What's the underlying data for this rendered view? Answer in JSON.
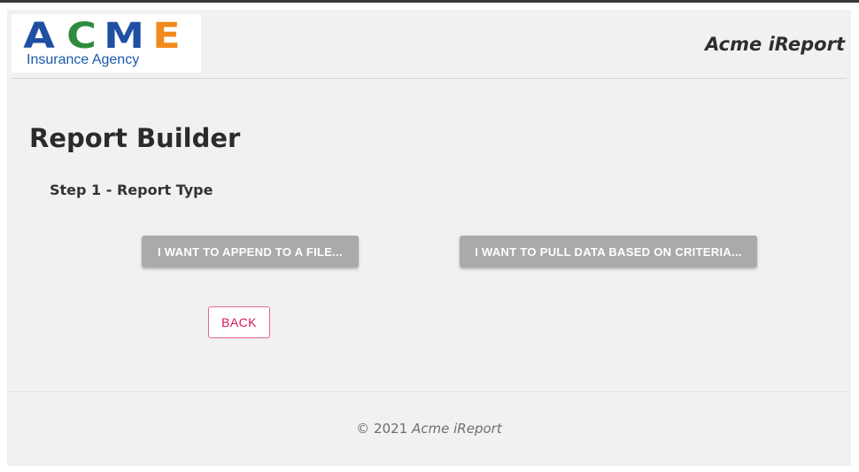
{
  "header": {
    "logo": {
      "word": [
        "A",
        "C",
        "M",
        "E"
      ],
      "colors": [
        "#1f4fa3",
        "#2e8c3c",
        "#1f4fa3",
        "#f08a1c"
      ],
      "subtitle": "Insurance Agency"
    },
    "app_title": "Acme iReport"
  },
  "main": {
    "title": "Report Builder",
    "step": "Step 1 - Report Type",
    "buttons": {
      "append": "I WANT TO APPEND TO A FILE...",
      "pull": "I WANT TO PULL DATA BASED ON CRITERIA...",
      "back": "BACK"
    }
  },
  "footer": {
    "copyright": "© 2021",
    "app_name": "Acme iReport"
  },
  "colors": {
    "page_bg": "#f1f1f1",
    "button_gray": "#aaaaaa",
    "back_accent": "#d6175a"
  }
}
